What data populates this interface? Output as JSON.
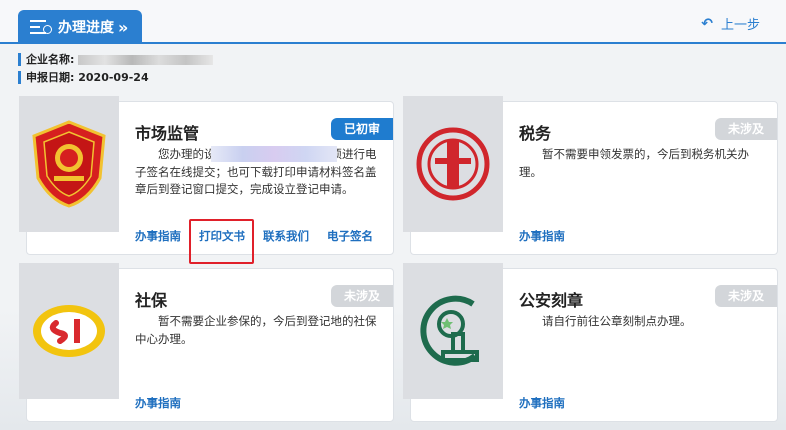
{
  "header": {
    "tab_title": "办理进度",
    "tab_arrow": "»",
    "back_label": "上一步",
    "back_icon": "undo-arrow"
  },
  "info": {
    "company_label": "企业名称:",
    "date_label": "申报日期:",
    "date_value": "2020-09-24"
  },
  "cards": [
    {
      "title": "市场监管",
      "badge": "已初审",
      "desc": "您办理的设立登记申请已初审，现须进行电子签名在线提交；也可下载打印申请材料签名盖章后到登记窗口提交，完成设立登记申请。",
      "links": [
        "办事指南",
        "打印文书",
        "联系我们",
        "电子签名"
      ]
    },
    {
      "title": "税务",
      "badge": "未涉及",
      "desc": "暂不需要申领发票的，今后到税务机关办理。",
      "links": [
        "办事指南"
      ]
    },
    {
      "title": "社保",
      "badge": "未涉及",
      "desc": "暂不需要企业参保的，今后到登记地的社保中心办理。",
      "links": [
        "办事指南"
      ]
    },
    {
      "title": "公安刻章",
      "badge": "未涉及",
      "desc": "请自行前往公章刻制点办理。",
      "links": [
        "办事指南"
      ]
    }
  ]
}
